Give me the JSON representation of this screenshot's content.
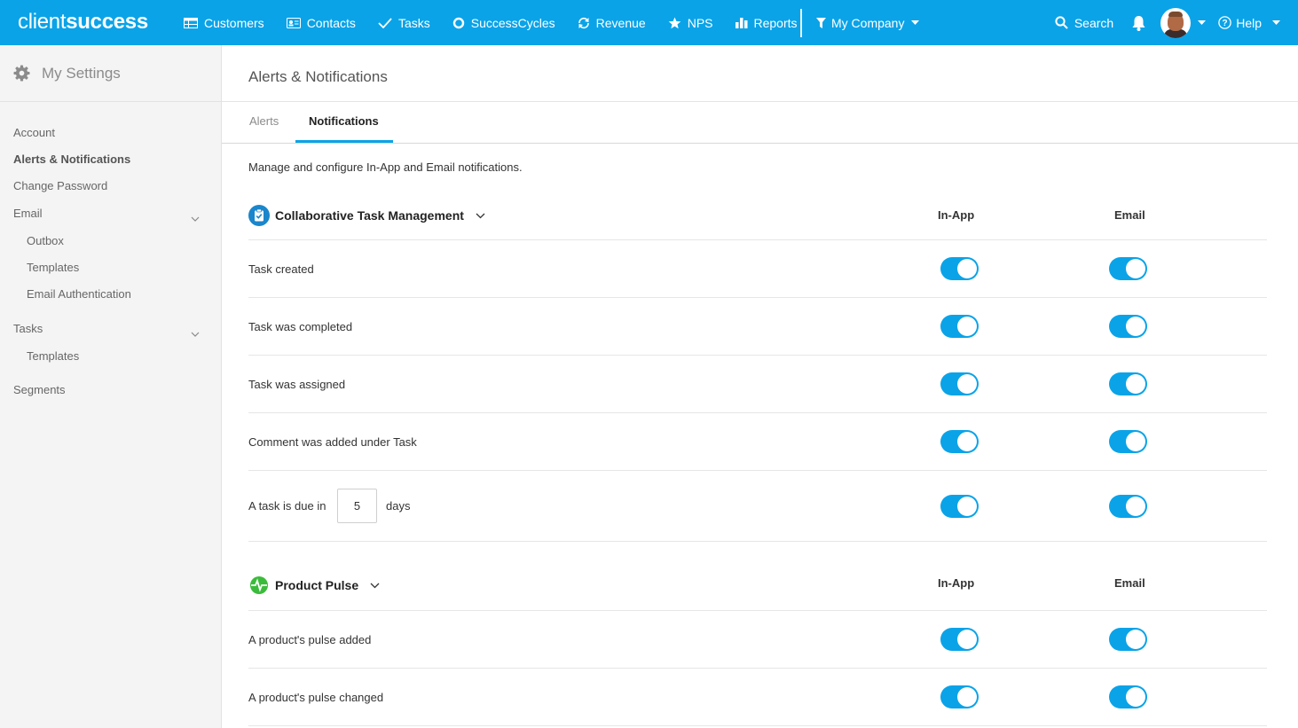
{
  "brand": {
    "part1": "client",
    "part2": "success",
    "accent": "#0aa3e8"
  },
  "nav": {
    "items": [
      {
        "label": "Customers",
        "icon": "table-icon"
      },
      {
        "label": "Contacts",
        "icon": "id-card-icon"
      },
      {
        "label": "Tasks",
        "icon": "check-icon"
      },
      {
        "label": "SuccessCycles",
        "icon": "circle-icon"
      },
      {
        "label": "Revenue",
        "icon": "refresh-icon"
      },
      {
        "label": "NPS",
        "icon": "star-icon"
      },
      {
        "label": "Reports",
        "icon": "bar-chart-icon"
      }
    ],
    "company": "My Company",
    "search": "Search",
    "help": "Help"
  },
  "sidebar": {
    "title": "My Settings",
    "items": [
      "Account",
      "Alerts & Notifications",
      "Change Password",
      "Email",
      "Outbox",
      "Templates",
      "Email Authentication",
      "Tasks",
      "Templates",
      "Segments"
    ],
    "active": "Alerts & Notifications"
  },
  "page": {
    "title": "Alerts & Notifications",
    "tabs": [
      "Alerts",
      "Notifications"
    ],
    "active_tab": "Notifications",
    "description": "Manage and configure In-App and Email notifications."
  },
  "sections": [
    {
      "title": "Collaborative Task Management",
      "col_inapp": "In-App",
      "col_email": "Email",
      "rows": [
        {
          "label": "Task created",
          "in_app": true,
          "email": true
        },
        {
          "label": "Task was completed",
          "in_app": true,
          "email": true
        },
        {
          "label": "Task was assigned",
          "in_app": true,
          "email": true
        },
        {
          "label": "Comment was added under Task",
          "in_app": true,
          "email": true
        },
        {
          "label": "A task is due in",
          "days_value": "5",
          "days_suffix": "days",
          "in_app": true,
          "email": true
        }
      ]
    },
    {
      "title": "Product Pulse",
      "col_inapp": "In-App",
      "col_email": "Email",
      "rows": [
        {
          "label": "A product's pulse added",
          "in_app": true,
          "email": true
        },
        {
          "label": "A product's pulse changed",
          "in_app": true,
          "email": true
        }
      ]
    }
  ]
}
